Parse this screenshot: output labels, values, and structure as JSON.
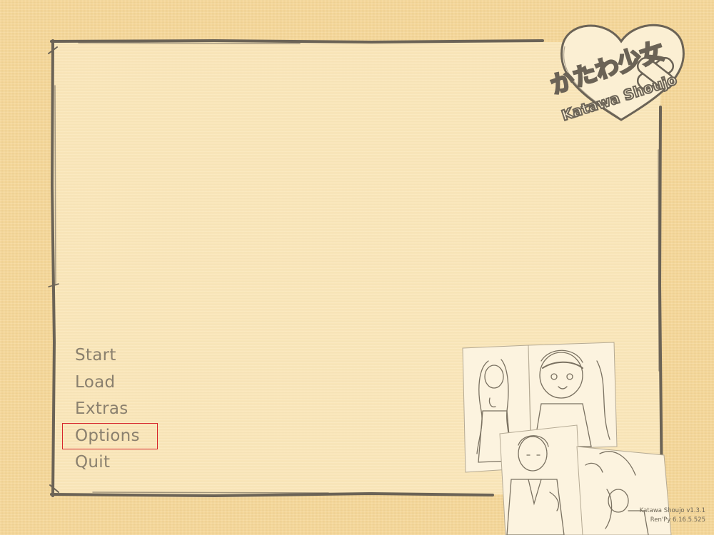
{
  "game": {
    "logo_title_jp": "かたわ少女",
    "logo_title_en": "Katawa Shoujo"
  },
  "main_menu": {
    "items": [
      {
        "label": "Start"
      },
      {
        "label": "Load"
      },
      {
        "label": "Extras"
      },
      {
        "label": "Options",
        "selected": true
      },
      {
        "label": "Quit"
      }
    ]
  },
  "version": {
    "game_version": "Katawa Shoujo v1.3.1",
    "engine_version": "Ren'Py 6.16.5.525"
  },
  "colors": {
    "background": "#f6d797",
    "panel": "#fae6b8",
    "frame_stroke": "#6b6356",
    "menu_text": "#8a806e",
    "selection_outline": "#d7262b"
  }
}
